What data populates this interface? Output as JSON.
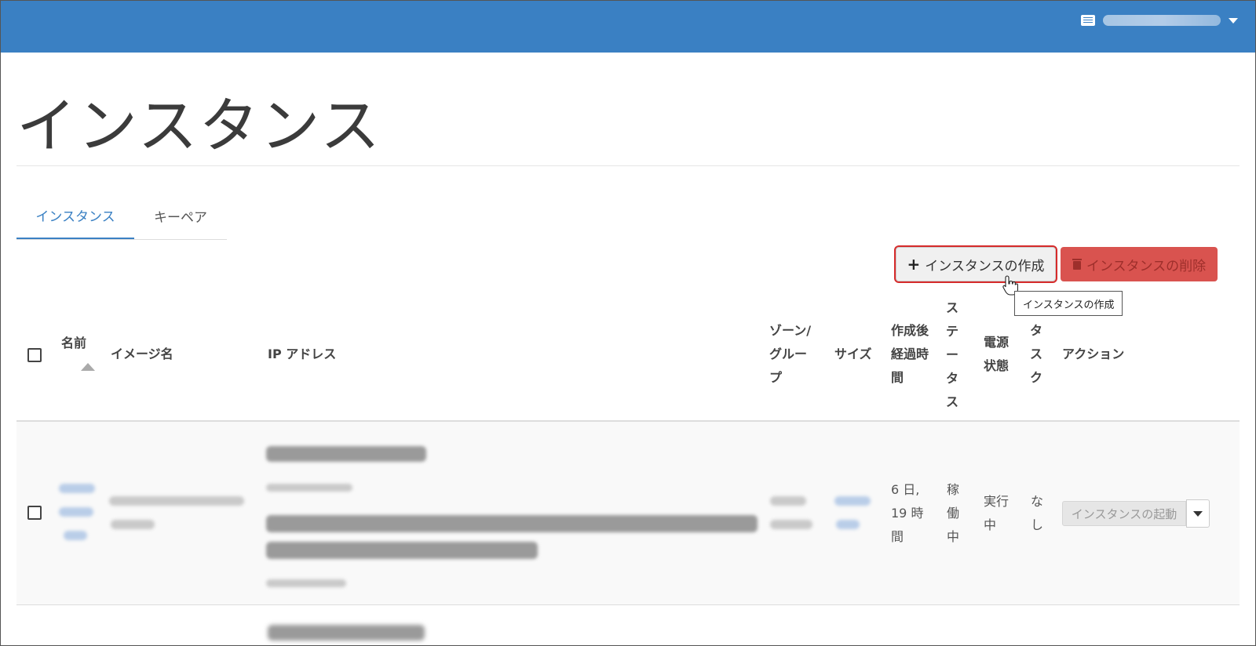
{
  "header": {
    "user_menu": {
      "icon": "list-icon",
      "username": ""
    },
    "accent_color": "#3a80c3"
  },
  "page": {
    "title": "インスタンス"
  },
  "tabs": [
    {
      "label": "インスタンス",
      "active": true
    },
    {
      "label": "キーペア",
      "active": false
    }
  ],
  "toolbar": {
    "create_label": "インスタンスの作成",
    "delete_label": "インスタンスの削除",
    "tooltip": "インスタンスの作成",
    "create_color": "#f0f0f0",
    "delete_color": "#d9534f",
    "highlight_color": "#d62b2b"
  },
  "table": {
    "columns": {
      "name": "名前",
      "image": "イメージ名",
      "ip": "IP アドレス",
      "zone": [
        "ゾーン/",
        "グルー",
        "プ"
      ],
      "size": "サイズ",
      "age": [
        "作成後",
        "経過時",
        "間"
      ],
      "status": [
        "ス",
        "テ",
        "ー",
        "タ",
        "ス"
      ],
      "power": [
        "電源",
        "状態"
      ],
      "task": [
        "タ",
        "ス",
        "ク"
      ],
      "actions": "アクション"
    },
    "rows": [
      {
        "age": [
          "6 日,",
          "19 時",
          "間"
        ],
        "status": [
          "稼",
          "働",
          "中"
        ],
        "power": [
          "実行",
          "中"
        ],
        "task": [
          "な",
          "し"
        ],
        "action_label": "インスタンスの起動"
      }
    ]
  }
}
